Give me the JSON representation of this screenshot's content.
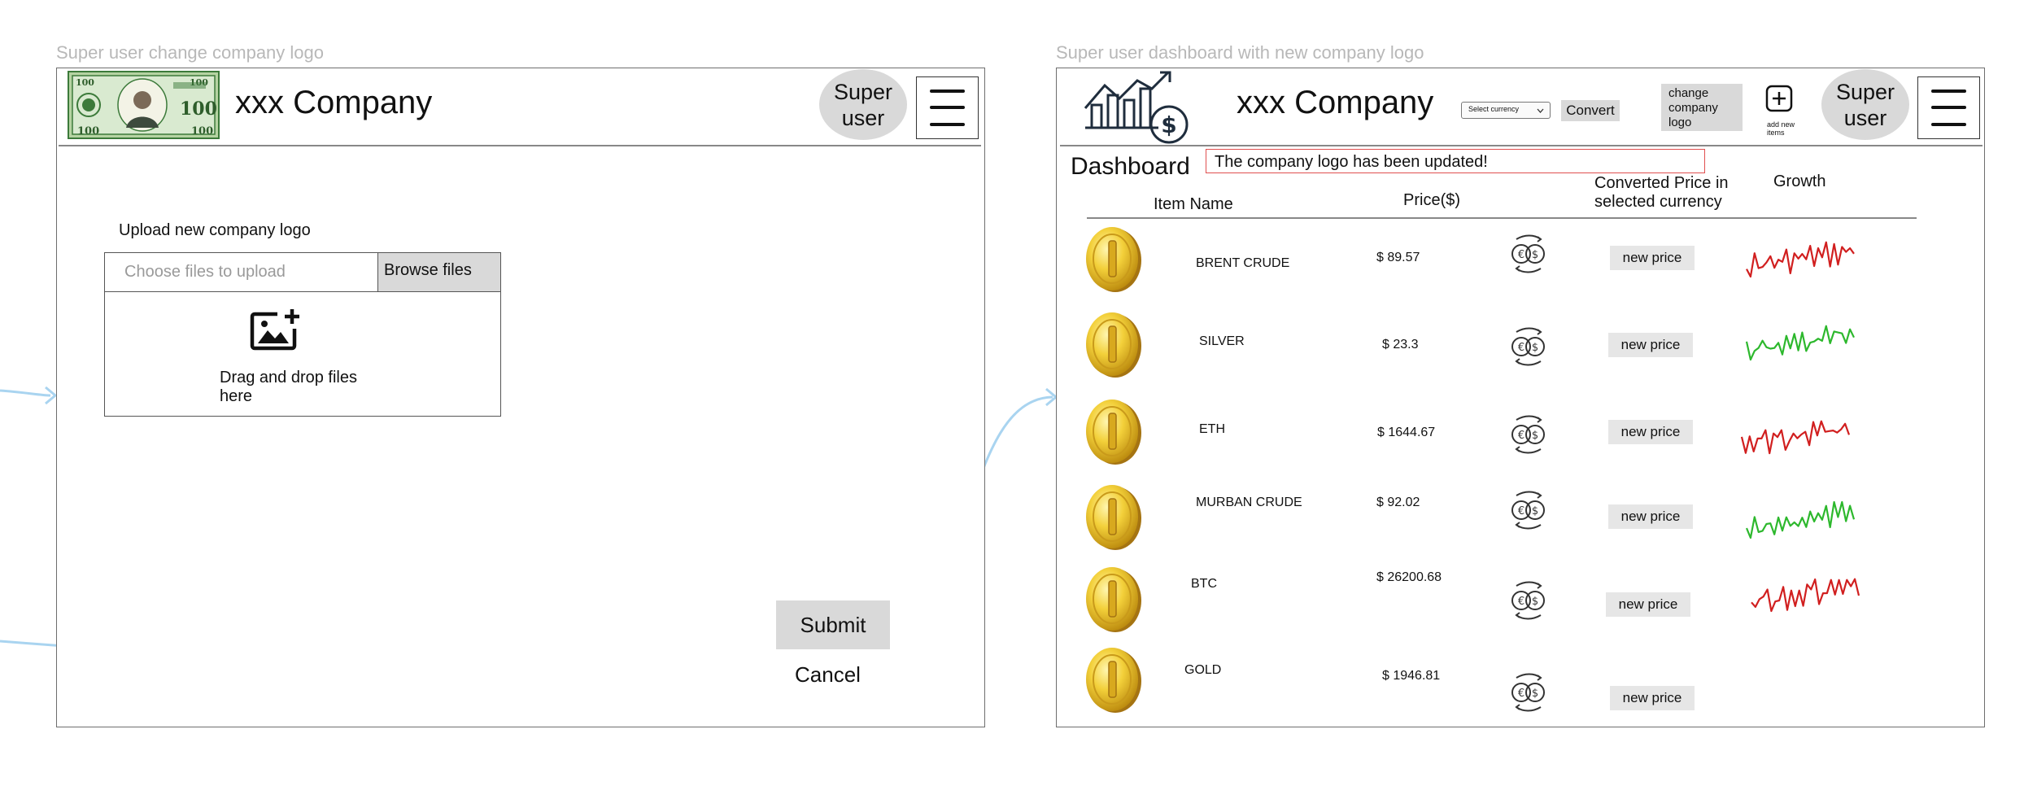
{
  "left_screen": {
    "frame_title": "Super user change company logo",
    "company_name": "xxx Company",
    "logo_icon": "dollar-bill-logo",
    "user_label": "Super user",
    "menu_icon": "hamburger-menu-icon",
    "upload": {
      "heading": "Upload new company logo",
      "placeholder": "Choose files to upload",
      "browse_label": "Browse files",
      "drop_icon": "add-image-icon",
      "drop_text": "Drag and drop files here"
    },
    "submit_label": "Submit",
    "cancel_label": "Cancel"
  },
  "right_screen": {
    "frame_title": "Super user dashboard with new company logo",
    "company_name": "xxx Company",
    "logo_icon": "growth-chart-dollar-logo",
    "currency_select": {
      "selected": "Select currency",
      "icon": "chevron-down-icon"
    },
    "convert_label": "Convert",
    "change_logo_label": "change company logo",
    "add_items_label": "add new items",
    "add_icon": "plus-square-icon",
    "user_label": "Super user",
    "menu_icon": "hamburger-menu-icon",
    "dashboard_title": "Dashboard",
    "notification": "The company logo has been updated!",
    "columns": {
      "item_name": "Item Name",
      "price": "Price($)",
      "converted": "Converted Price in selected currency",
      "growth": "Growth"
    },
    "rows": [
      {
        "name": "BRENT CRUDE",
        "price": "$ 89.57",
        "button": "new price",
        "growth": "down"
      },
      {
        "name": "SILVER",
        "price": "$ 23.3",
        "button": "new price",
        "growth": "up"
      },
      {
        "name": "ETH",
        "price": "$ 1644.67",
        "button": "new price",
        "growth": "down"
      },
      {
        "name": "MURBAN CRUDE",
        "price": "$ 92.02",
        "button": "new price",
        "growth": "up"
      },
      {
        "name": "BTC",
        "price": "$ 26200.68",
        "button": "new price",
        "growth": "down"
      },
      {
        "name": "GOLD",
        "price": "$ 1946.81",
        "button": "new price",
        "growth": ""
      }
    ],
    "row_icons": {
      "coin": "gold-coin-icon",
      "convert": "currency-exchange-icon",
      "growth": "sparkline-icon"
    },
    "colors": {
      "growth_up": "#2db82d",
      "growth_down": "#d11f1f",
      "notification_border": "#e05050",
      "connector": "#a9d4f0"
    }
  }
}
